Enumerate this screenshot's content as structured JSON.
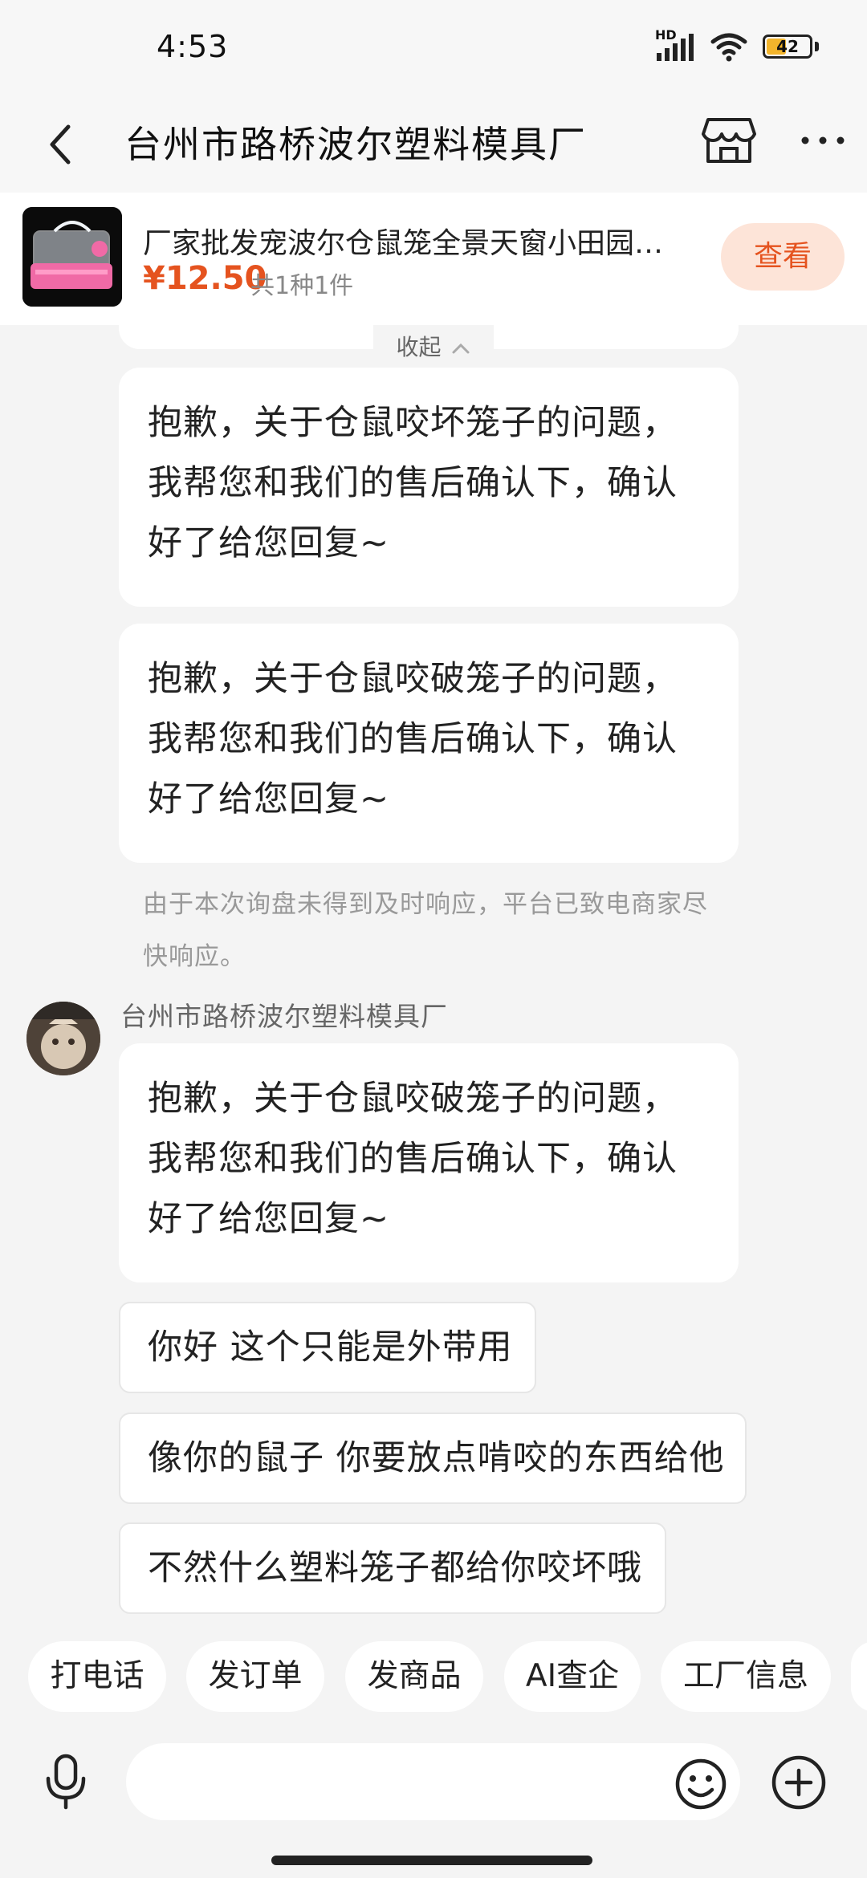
{
  "status_bar": {
    "time": "4:53",
    "network_badge": "HD",
    "battery_level": "42",
    "battery_fraction": 0.42
  },
  "header": {
    "title": "台州市路桥波尔塑料模具厂",
    "back_icon": "chevron-left-icon",
    "shop_icon": "shop-icon",
    "more_icon": "more-dots-icon"
  },
  "product": {
    "title": "厂家批发宠波尔仓鼠笼全景天窗小田园…",
    "price": "¥12.50",
    "count": "共1种1件",
    "view_label": "查看"
  },
  "chat": {
    "collapse_label": "收起",
    "messages": [
      {
        "text": "抱歉，关于仓鼠咬坏笼子的问题，我帮您和我们的售后确认下，确认好了给您回复~"
      },
      {
        "text": "抱歉，关于仓鼠咬破笼子的问题，我帮您和我们的售后确认下，确认好了给您回复~"
      }
    ],
    "system_notice": "由于本次询盘未得到及时响应，平台已致电商家尽快响应。",
    "sender_name": "台州市路桥波尔塑料模具厂",
    "sender_messages": [
      {
        "text": "抱歉，关于仓鼠咬破笼子的问题，我帮您和我们的售后确认下，确认好了给您回复~"
      },
      {
        "text": "你好 这个只能是外带用"
      },
      {
        "text": "像你的鼠子 你要放点啃咬的东西给他"
      },
      {
        "text": "不然什么塑料笼子都给你咬坏哦"
      }
    ]
  },
  "quick_actions": [
    "打电话",
    "发订单",
    "发商品",
    "AI查企",
    "工厂信息"
  ],
  "input": {
    "placeholder": "",
    "value": ""
  }
}
